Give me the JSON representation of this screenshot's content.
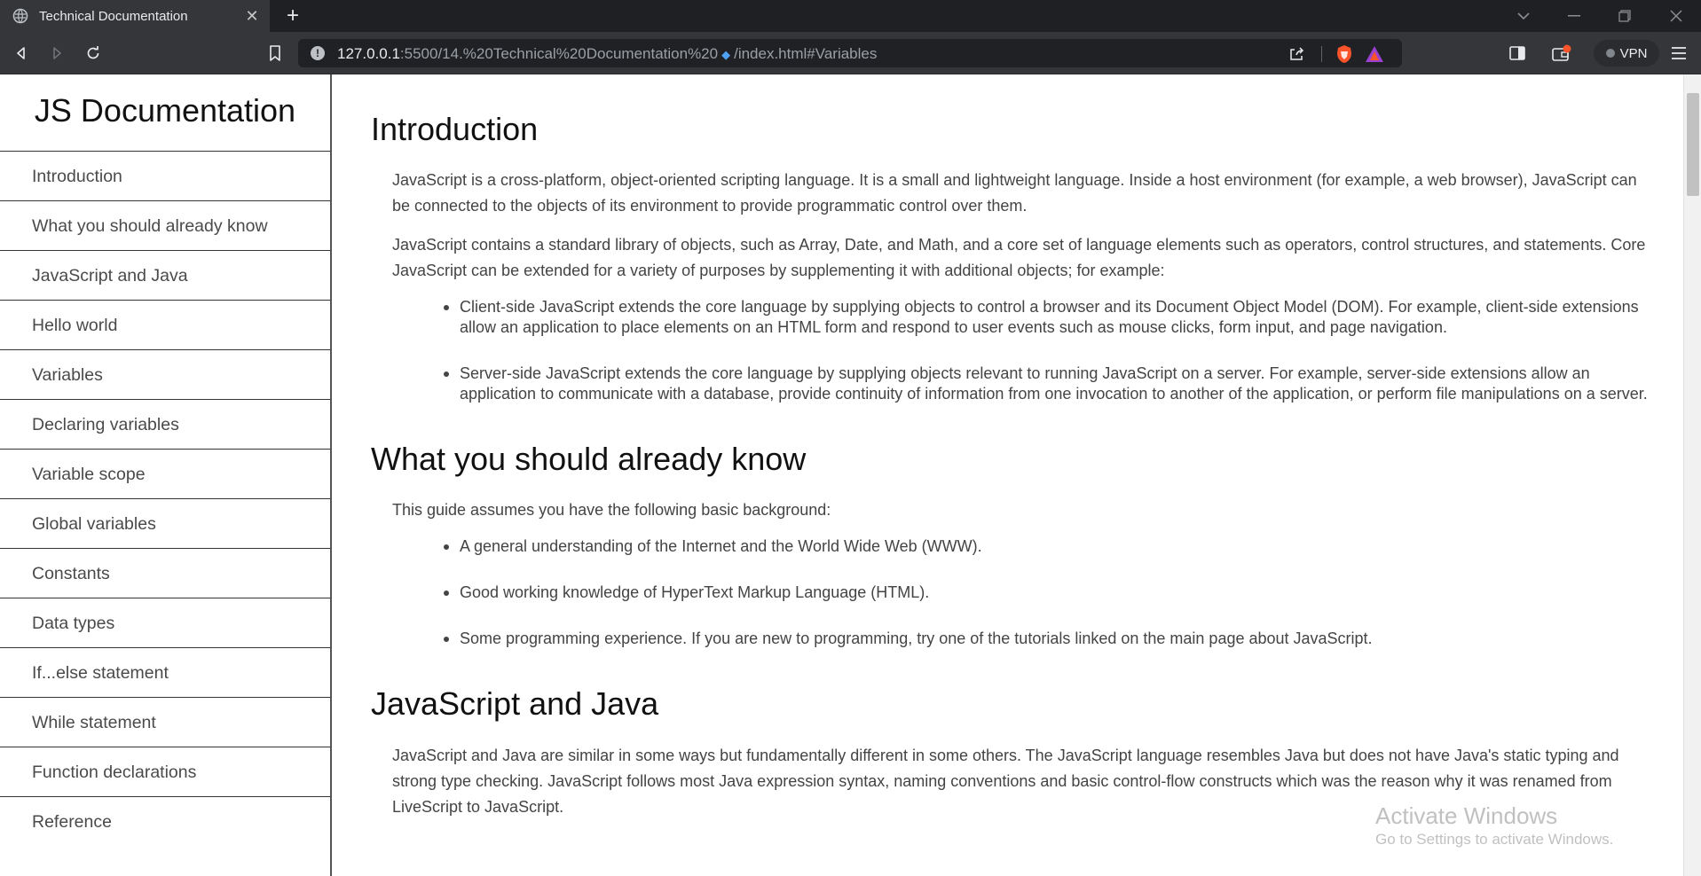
{
  "browser": {
    "tab_title": "Technical Documentation",
    "tab_close": "✕",
    "new_tab": "+",
    "url_host": "127.0.0.1",
    "url_path": ":5500/14.%20Technical%20Documentation%20",
    "url_diamond": "◆",
    "url_tail": "/index.html#Variables",
    "lock_glyph": "!",
    "vpn_label": "VPN",
    "brave_color": "#fb542b",
    "accent_blue": "#4fa3f7"
  },
  "nav": {
    "title": "JS Documentation",
    "links": [
      "Introduction",
      "What you should already know",
      "JavaScript and Java",
      "Hello world",
      "Variables",
      "Declaring variables",
      "Variable scope",
      "Global variables",
      "Constants",
      "Data types",
      "If...else statement",
      "While statement",
      "Function declarations",
      "Reference"
    ]
  },
  "sections": {
    "introduction": {
      "heading": "Introduction",
      "p1": "JavaScript is a cross-platform, object-oriented scripting language. It is a small and lightweight language. Inside a host environment (for example, a web browser), JavaScript can be connected to the objects of its environment to provide programmatic control over them.",
      "p2": "JavaScript contains a standard library of objects, such as Array, Date, and Math, and a core set of language elements such as operators, control structures, and statements. Core JavaScript can be extended for a variety of purposes by supplementing it with additional objects; for example:",
      "items": [
        "Client-side JavaScript extends the core language by supplying objects to control a browser and its Document Object Model (DOM). For example, client-side extensions allow an application to place elements on an HTML form and respond to user events such as mouse clicks, form input, and page navigation.",
        "Server-side JavaScript extends the core language by supplying objects relevant to running JavaScript on a server. For example, server-side extensions allow an application to communicate with a database, provide continuity of information from one invocation to another of the application, or perform file manipulations on a server."
      ]
    },
    "know": {
      "heading": "What you should already know",
      "p1": "This guide assumes you have the following basic background:",
      "items": [
        "A general understanding of the Internet and the World Wide Web (WWW).",
        "Good working knowledge of HyperText Markup Language (HTML).",
        "Some programming experience. If you are new to programming, try one of the tutorials linked on the main page about JavaScript."
      ]
    },
    "java": {
      "heading": "JavaScript and Java",
      "p1": "JavaScript and Java are similar in some ways but fundamentally different in some others. The JavaScript language resembles Java but does not have Java's static typing and strong type checking. JavaScript follows most Java expression syntax, naming conventions and basic control-flow constructs which was the reason why it was renamed from LiveScript to JavaScript."
    }
  },
  "watermark": {
    "title": "Activate Windows",
    "subtitle": "Go to Settings to activate Windows."
  }
}
